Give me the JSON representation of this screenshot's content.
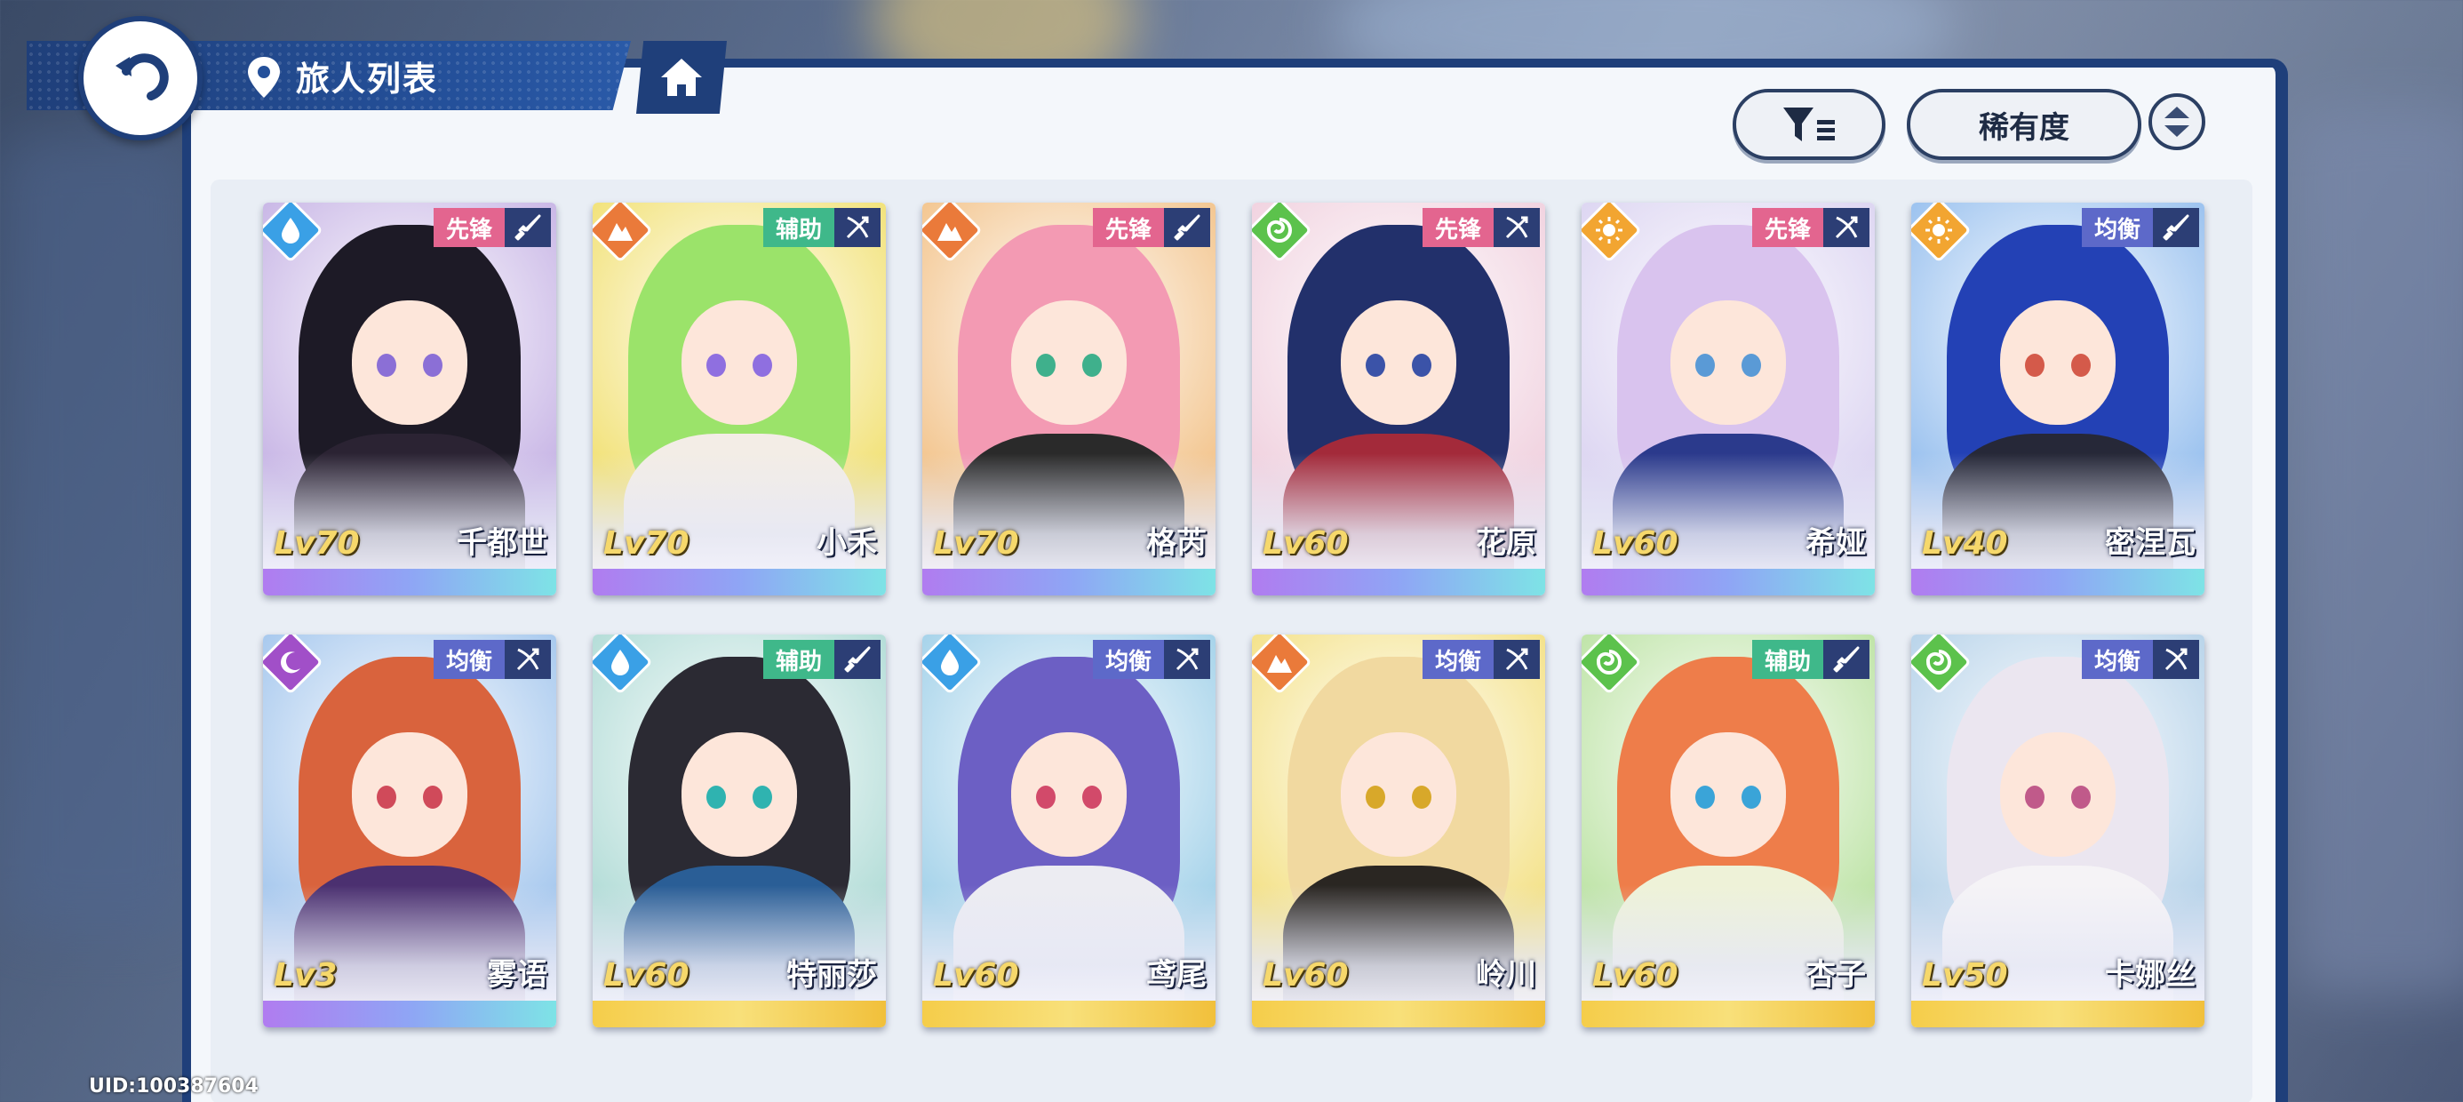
{
  "header": {
    "title": "旅人列表"
  },
  "toolbar": {
    "sort_label": "稀有度"
  },
  "footer": {
    "uid": "UID:100387604"
  },
  "colors": {
    "accent": "#1f3f7a",
    "role_vanguard": "#e3658f",
    "role_support": "#3fb88a",
    "role_balance": "#5d69c9"
  },
  "characters": [
    {
      "name": "千都世",
      "level": "Lv70",
      "role": "先锋",
      "element": "water",
      "weapon": "sword",
      "strip": "purple",
      "hair": "#1d1a26",
      "outfit": "#2b2333",
      "bg": "#c9b7e6",
      "eye": "#8b6fd6"
    },
    {
      "name": "小禾",
      "level": "Lv70",
      "role": "辅助",
      "element": "earth",
      "weapon": "bow",
      "strip": "purple",
      "hair": "#9be36a",
      "outfit": "#f3ede6",
      "bg": "#f2e27a",
      "eye": "#8f6fe0"
    },
    {
      "name": "格芮",
      "level": "Lv70",
      "role": "先锋",
      "element": "earth",
      "weapon": "sword",
      "strip": "purple",
      "hair": "#f39ab3",
      "outfit": "#2a2a2a",
      "bg": "#f3c690",
      "eye": "#3fb08c"
    },
    {
      "name": "花原",
      "level": "Lv60",
      "role": "先锋",
      "element": "wind",
      "weapon": "bow",
      "strip": "purple",
      "hair": "#22306b",
      "outfit": "#a32a3a",
      "bg": "#f1d3e0",
      "eye": "#3b53a8"
    },
    {
      "name": "希娅",
      "level": "Lv60",
      "role": "先锋",
      "element": "light",
      "weapon": "bow",
      "strip": "purple",
      "hair": "#d9c3ee",
      "outfit": "#2b3a8c",
      "bg": "#ddd6f2",
      "eye": "#5a9ad6"
    },
    {
      "name": "密涅瓦",
      "level": "Lv40",
      "role": "均衡",
      "element": "light",
      "weapon": "sword",
      "strip": "purple",
      "hair": "#2341b5",
      "outfit": "#262838",
      "bg": "#9bc2ef",
      "eye": "#d45a4a"
    },
    {
      "name": "雾语",
      "level": "Lv3",
      "role": "均衡",
      "element": "dark",
      "weapon": "bow",
      "strip": "purple",
      "hair": "#d9633d",
      "outfit": "#4b3070",
      "bg": "#a8c9ee",
      "eye": "#d04a5a"
    },
    {
      "name": "特丽莎",
      "level": "Lv60",
      "role": "辅助",
      "element": "water",
      "weapon": "sword",
      "strip": "gold",
      "hair": "#2b2a33",
      "outfit": "#2a5e96",
      "bg": "#b4ddd8",
      "eye": "#2fb3b0"
    },
    {
      "name": "鸢尾",
      "level": "Lv60",
      "role": "均衡",
      "element": "water",
      "weapon": "bow",
      "strip": "gold",
      "hair": "#6c5fc4",
      "outfit": "#ececf2",
      "bg": "#a6d3ea",
      "eye": "#d24a6a"
    },
    {
      "name": "岭川",
      "level": "Lv60",
      "role": "均衡",
      "element": "earth",
      "weapon": "bow",
      "strip": "gold",
      "hair": "#f1d9a0",
      "outfit": "#2a2622",
      "bg": "#f4e28b",
      "eye": "#d8a82a"
    },
    {
      "name": "杏子",
      "level": "Lv60",
      "role": "辅助",
      "element": "wind",
      "weapon": "sword",
      "strip": "gold",
      "hair": "#ee7d4a",
      "outfit": "#eef2d8",
      "bg": "#bfe4a8",
      "eye": "#3aa4d8"
    },
    {
      "name": "卡娜丝",
      "level": "Lv50",
      "role": "均衡",
      "element": "wind",
      "weapon": "bow",
      "strip": "gold",
      "hair": "#ebe6f0",
      "outfit": "#f5f3f6",
      "bg": "#b9d4ea",
      "eye": "#c05a8a"
    }
  ]
}
